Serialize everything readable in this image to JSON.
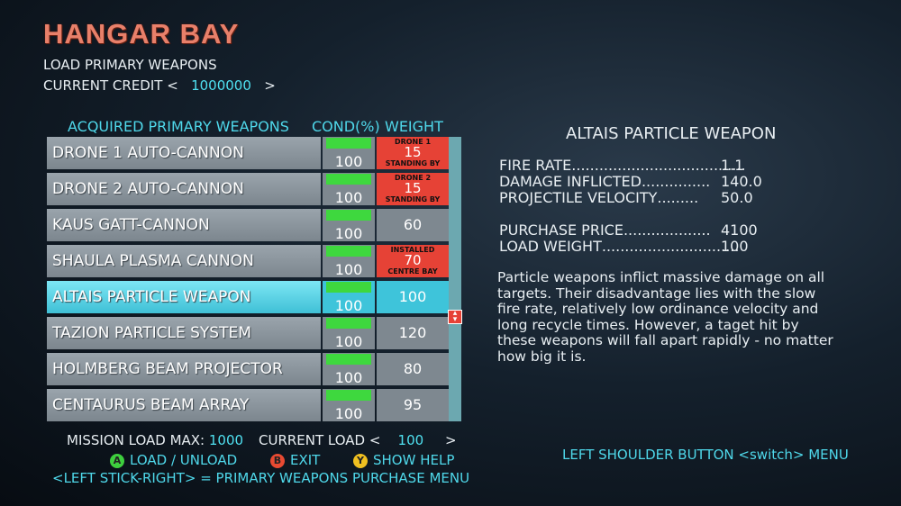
{
  "header": {
    "title": "HANGAR BAY",
    "subtitle": "LOAD PRIMARY WEAPONS",
    "credit_label": "CURRENT CREDIT <",
    "credit_value": "1000000",
    "credit_suffix": ">"
  },
  "columns": {
    "acquired": "ACQUIRED PRIMARY WEAPONS",
    "cond": "COND(%)",
    "weight": "WEIGHT"
  },
  "weapons": [
    {
      "name": "DRONE 1 AUTO-CANNON",
      "cond": "100",
      "cond_fraction": 1.0,
      "weight": "15",
      "status_top": "DRONE 1",
      "status_bottom": "STANDING BY",
      "highlight": "red"
    },
    {
      "name": "DRONE 2 AUTO-CANNON",
      "cond": "100",
      "cond_fraction": 1.0,
      "weight": "15",
      "status_top": "DRONE 2",
      "status_bottom": "STANDING BY",
      "highlight": "red"
    },
    {
      "name": "KAUS GATT-CANNON",
      "cond": "100",
      "cond_fraction": 1.0,
      "weight": "60"
    },
    {
      "name": "SHAULA PLASMA CANNON",
      "cond": "100",
      "cond_fraction": 1.0,
      "weight": "70",
      "status_top": "INSTALLED",
      "status_bottom": "CENTRE BAY",
      "highlight": "red"
    },
    {
      "name": "ALTAIS PARTICLE WEAPON",
      "cond": "100",
      "cond_fraction": 1.0,
      "weight": "100",
      "selected": true
    },
    {
      "name": "TAZION PARTICLE SYSTEM",
      "cond": "100",
      "cond_fraction": 1.0,
      "weight": "120"
    },
    {
      "name": "HOLMBERG BEAM PROJECTOR",
      "cond": "100",
      "cond_fraction": 1.0,
      "weight": "80"
    },
    {
      "name": "CENTAURUS BEAM ARRAY",
      "cond": "100",
      "cond_fraction": 1.0,
      "weight": "95"
    }
  ],
  "footer": {
    "mission_label": "MISSION LOAD MAX:",
    "mission_value": "1000",
    "current_label": "CURRENT LOAD <",
    "current_value": "100",
    "current_suffix": ">",
    "btn_a_glyph": "A",
    "btn_a_label": "LOAD / UNLOAD",
    "btn_b_glyph": "B",
    "btn_b_label": "EXIT",
    "btn_y_glyph": "Y",
    "btn_y_label": "SHOW HELP",
    "stick_hint": "<LEFT STICK-RIGHT> = PRIMARY WEAPONS PURCHASE MENU",
    "shoulder_hint": "LEFT SHOULDER BUTTON <switch> MENU"
  },
  "detail": {
    "title": "ALTAIS PARTICLE WEAPON",
    "stats": [
      {
        "label": "FIRE RATE",
        "dots": " ......................................",
        "value": "1.1"
      },
      {
        "label": "DAMAGE INFLICTED",
        "dots": " ...............",
        "value": "140.0"
      },
      {
        "label": "PROJECTILE VELOCITY",
        "dots": " .........",
        "value": "50.0"
      }
    ],
    "stats2": [
      {
        "label": "PURCHASE PRICE",
        "dots": " ...................",
        "value": "4100"
      },
      {
        "label": "LOAD WEIGHT",
        "dots": " ..............................",
        "value": "100"
      }
    ],
    "description": "Particle weapons inflict massive damage on all targets. Their disadvantage lies with the slow fire rate, relatively low ordinance velocity and long recycle times. However, a taget hit by these weapons will fall apart rapidly - no matter how big it is."
  },
  "colors": {
    "accent_cyan": "#4fd8ea",
    "title_red": "#e8806a",
    "status_red": "#e64236",
    "cond_green": "#3ed83e",
    "btn_a": "#3ecf3e",
    "btn_b": "#e84a32",
    "btn_y": "#f0c020"
  }
}
